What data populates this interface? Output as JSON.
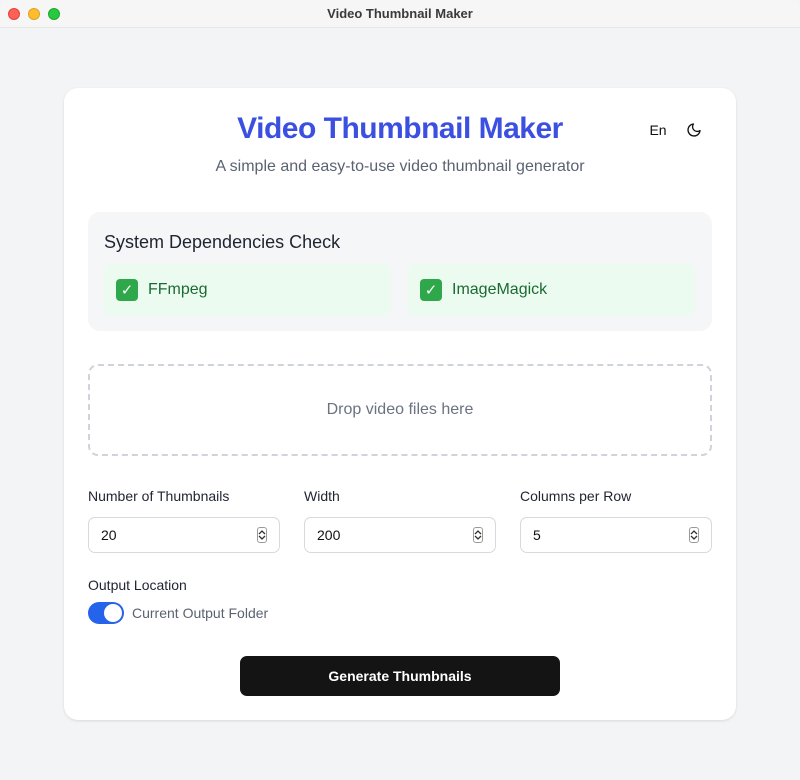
{
  "window": {
    "title": "Video Thumbnail Maker"
  },
  "header": {
    "title": "Video Thumbnail Maker",
    "subtitle": "A simple and easy-to-use video thumbnail generator",
    "language": "En"
  },
  "dependencies": {
    "title": "System Dependencies Check",
    "items": [
      {
        "label": "FFmpeg",
        "status": "ok"
      },
      {
        "label": "ImageMagick",
        "status": "ok"
      }
    ]
  },
  "dropzone": {
    "text": "Drop video files here"
  },
  "settings": {
    "thumbnails": {
      "label": "Number of Thumbnails",
      "value": "20"
    },
    "width": {
      "label": "Width",
      "value": "200"
    },
    "columns": {
      "label": "Columns per Row",
      "value": "5"
    }
  },
  "output": {
    "label": "Output Location",
    "toggle_label": "Current Output Folder",
    "toggle_on": true
  },
  "actions": {
    "generate_label": "Generate Thumbnails"
  },
  "colors": {
    "accent": "#3b4fe0",
    "toggle": "#2563eb",
    "success": "#2ea84a",
    "button": "#141414"
  },
  "icons": {
    "theme": "moon-icon",
    "dependency_ok": "check-icon"
  }
}
